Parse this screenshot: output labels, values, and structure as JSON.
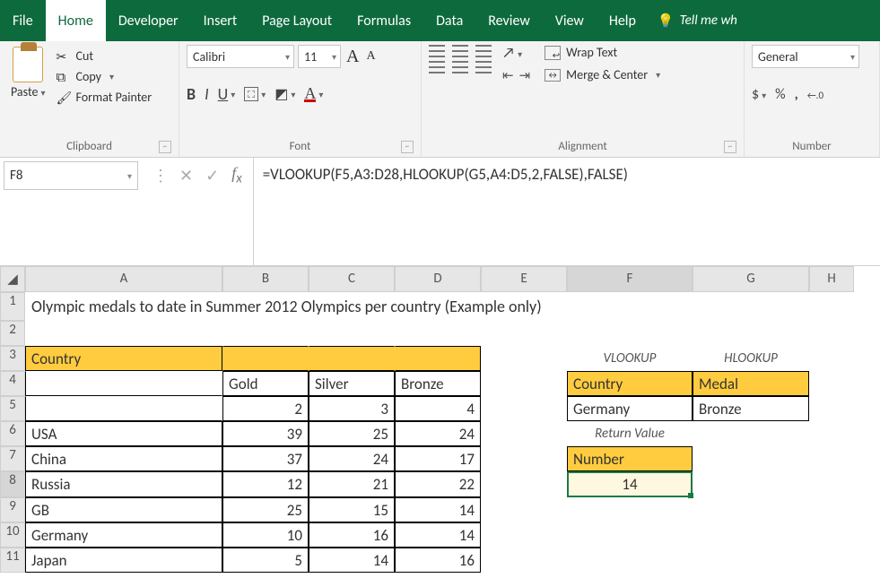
{
  "tabs": {
    "file": "File",
    "home": "Home",
    "developer": "Developer",
    "insert": "Insert",
    "pagelayout": "Page Layout",
    "formulas": "Formulas",
    "data": "Data",
    "review": "Review",
    "view": "View",
    "help": "Help",
    "tellme": "Tell me wh"
  },
  "clipboard": {
    "paste": "Paste",
    "cut": "Cut",
    "copy": "Copy",
    "format_painter": "Format Painter",
    "group": "Clipboard"
  },
  "font": {
    "name": "Calibri",
    "size": "11",
    "group": "Font"
  },
  "alignment": {
    "wrap": "Wrap Text",
    "merge": "Merge & Center",
    "group": "Alignment"
  },
  "number": {
    "format": "General",
    "group": "Number"
  },
  "namebox": "F8",
  "formula": "=VLOOKUP(F5,A3:D28,HLOOKUP(G5,A4:D5,2,FALSE),FALSE)",
  "cols": [
    "A",
    "B",
    "C",
    "D",
    "E",
    "F",
    "G",
    "H"
  ],
  "rows": [
    "1",
    "2",
    "3",
    "4",
    "5",
    "6",
    "7",
    "8",
    "9",
    "10",
    "11"
  ],
  "title": "Olympic medals to date in Summer 2012 Olympics per country (Example only)",
  "t": {
    "country_hdr": "Country",
    "gold": "Gold",
    "silver": "Silver",
    "bronze": "Bronze",
    "row5": {
      "g": "2",
      "s": "3",
      "b": "4"
    },
    "rows": [
      {
        "c": "USA",
        "g": "39",
        "s": "25",
        "b": "24"
      },
      {
        "c": "China",
        "g": "37",
        "s": "24",
        "b": "17"
      },
      {
        "c": "Russia",
        "g": "12",
        "s": "21",
        "b": "22"
      },
      {
        "c": "GB",
        "g": "25",
        "s": "15",
        "b": "14"
      },
      {
        "c": "Germany",
        "g": "10",
        "s": "16",
        "b": "14"
      },
      {
        "c": "Japan",
        "g": "5",
        "s": "14",
        "b": "16"
      }
    ]
  },
  "lk": {
    "vlookup": "VLOOKUP",
    "hlookup": "HLOOKUP",
    "country": "Country",
    "medal": "Medal",
    "country_v": "Germany",
    "medal_v": "Bronze",
    "retval": "Return Value",
    "number": "Number",
    "result": "14"
  }
}
